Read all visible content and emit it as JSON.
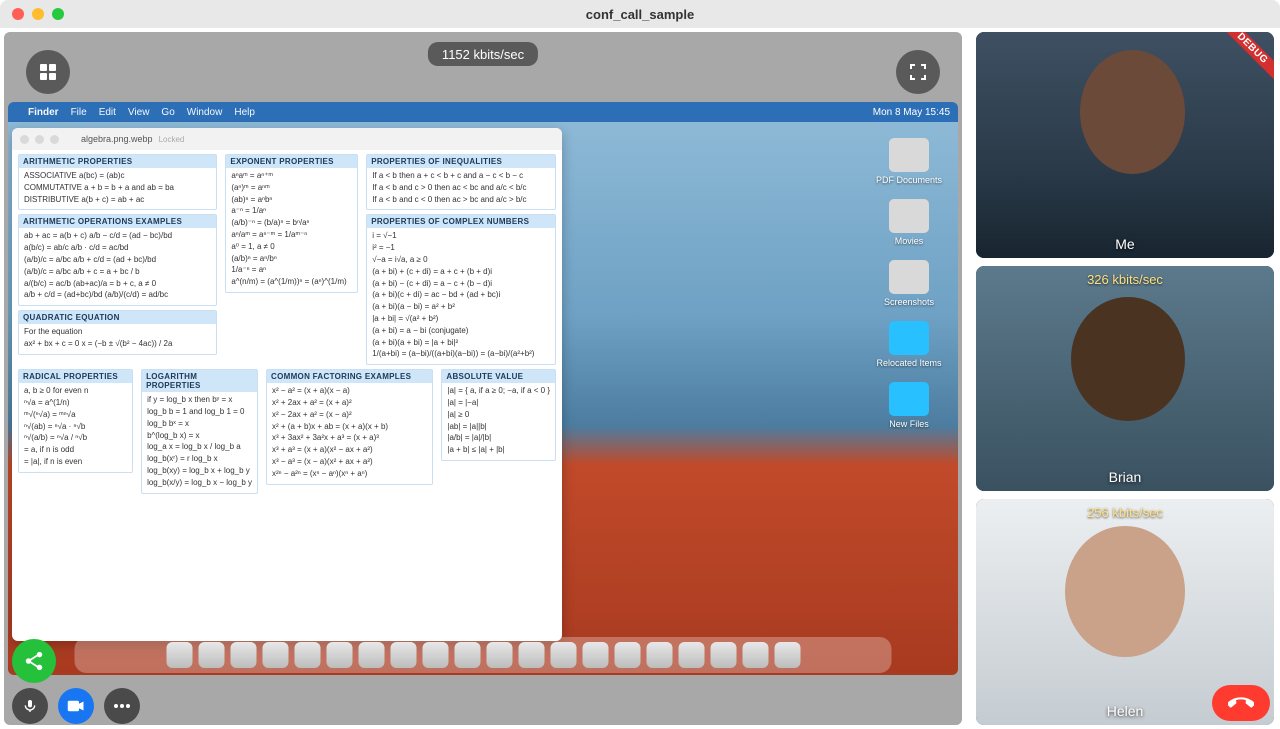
{
  "window": {
    "title": "conf_call_sample"
  },
  "overlay": {
    "bitrate": "1152 kbits/sec"
  },
  "menubar": {
    "items": [
      "Finder",
      "File",
      "Edit",
      "View",
      "Go",
      "Window",
      "Help"
    ],
    "clock": "Mon 8 May  15:45"
  },
  "doc": {
    "filename": "algebra.png.webp",
    "status": "Locked",
    "sections": {
      "arith_prop": {
        "title": "ARITHMETIC PROPERTIES",
        "rows": [
          "ASSOCIATIVE      a(bc) = (ab)c",
          "COMMUTATIVE    a + b = b + a  and  ab = ba",
          "DISTRIBUTIVE     a(b + c) = ab + ac"
        ]
      },
      "arith_ops": {
        "title": "ARITHMETIC OPERATIONS EXAMPLES",
        "rows": [
          "ab + ac = a(b + c)        a/b − c/d = (ad − bc)/bd",
          "a(b/c) = ab/c               a/b · c/d = ac/bd",
          "(a/b)/c = a/bc              a/b + c/d = (ad + bc)/bd",
          "(a/b)/c = a/bc              a/b + c = a + bc / b",
          "a/(b/c) = ac/b              (ab+ac)/a = b + c, a ≠ 0",
          "a/b + c/d = (ad+bc)/bd   (a/b)/(c/d) = ad/bc"
        ]
      },
      "quadratic": {
        "title": "QUADRATIC EQUATION",
        "rows": [
          "For the equation",
          "ax² + bx + c = 0     x = (−b ± √(b² − 4ac)) / 2a"
        ]
      },
      "radical": {
        "title": "RADICAL PROPERTIES",
        "rows": [
          "a, b ≥ 0 for even n",
          "ⁿ√a = a^(1/n)",
          "ᵐ√(ⁿ√a) = ᵐⁿ√a",
          "ⁿ√(ab) = ⁿ√a · ⁿ√b",
          "ⁿ√(a/b) = ⁿ√a / ⁿ√b",
          "= a, if n is odd",
          "= |a|, if n is even"
        ]
      },
      "exponent": {
        "title": "EXPONENT PROPERTIES",
        "rows": [
          "aⁿaᵐ = aⁿ⁺ᵐ",
          "(aⁿ)ᵐ = aⁿᵐ",
          "(ab)ⁿ = aⁿbⁿ",
          "a⁻ⁿ = 1/aⁿ",
          "(a/b)⁻ⁿ = (b/a)ⁿ = bⁿ/aⁿ",
          "aⁿ/aᵐ = aⁿ⁻ᵐ = 1/aᵐ⁻ⁿ",
          "a⁰ = 1, a ≠ 0",
          "(a/b)ⁿ = aⁿ/bⁿ",
          "1/a⁻ⁿ = aⁿ",
          "a^(n/m) = (a^(1/m))ⁿ = (aⁿ)^(1/m)"
        ]
      },
      "logarithm": {
        "title": "LOGARITHM PROPERTIES",
        "rows": [
          "if y = log_b x  then  bʸ = x",
          "log_b b = 1  and  log_b 1 = 0",
          "log_b bˣ = x",
          "b^(log_b x) = x",
          "log_a x = log_b x / log_b a",
          "log_b(xʳ) = r log_b x",
          "log_b(xy) = log_b x + log_b y",
          "log_b(x/y) = log_b x − log_b y"
        ]
      },
      "inequalities": {
        "title": "PROPERTIES OF INEQUALITIES",
        "rows": [
          "If a < b then a + c < b + c and a − c < b − c",
          "If a < b and c > 0 then ac < bc and a/c < b/c",
          "If a < b and c < 0 then ac > bc and a/c > b/c"
        ]
      },
      "complex": {
        "title": "PROPERTIES OF COMPLEX NUMBERS",
        "rows": [
          "i = √−1",
          "i² = −1",
          "√−a = i√a,     a ≥ 0",
          "(a + bi) + (c + di) = a + c + (b + d)i",
          "(a + bi) − (c + di) = a − c + (b − d)i",
          "(a + bi)(c + di) = ac − bd + (ad + bc)i",
          "(a + bi)(a − bi) = a² + b²",
          "|a + bi| = √(a² + b²)",
          "(a + bi) = a − bi   (conjugate)",
          "(a + bi)(a + bi) = |a + bi|²",
          "1/(a+bi) = (a−bi)/((a+bi)(a−bi)) = (a−bi)/(a²+b²)"
        ]
      },
      "factoring": {
        "title": "COMMON FACTORING EXAMPLES",
        "rows": [
          "x² − a² = (x + a)(x − a)",
          "x² + 2ax + a² = (x + a)²",
          "x² − 2ax + a² = (x − a)²",
          "x² + (a + b)x + ab = (x + a)(x + b)",
          "x³ + 3ax² + 3a²x + a³ = (x + a)³",
          "x³ + a³ = (x + a)(x² − ax + a²)",
          "x³ − a³ = (x − a)(x² + ax + a²)",
          "x²ⁿ − a²ⁿ = (xⁿ − aⁿ)(xⁿ + aⁿ)"
        ]
      },
      "absolute": {
        "title": "ABSOLUTE VALUE",
        "rows": [
          "|a| = { a, if a ≥ 0;  −a, if a < 0 }",
          "|a| = |−a|",
          "|a| ≥ 0",
          "|ab| = |a||b|",
          "|a/b| = |a|/|b|",
          "|a + b| ≤ |a| + |b|"
        ]
      }
    }
  },
  "desktop": {
    "icons": [
      {
        "label": "PDF Documents",
        "kind": "file"
      },
      {
        "label": "Movies",
        "kind": "file"
      },
      {
        "label": "Screenshots",
        "kind": "file"
      },
      {
        "label": "Relocated Items",
        "kind": "folder"
      },
      {
        "label": "New Files",
        "kind": "folder"
      }
    ]
  },
  "participants": [
    {
      "name": "Me",
      "bitrate": "",
      "debug": true
    },
    {
      "name": "Brian",
      "bitrate": "326 kbits/sec",
      "debug": false
    },
    {
      "name": "Helen",
      "bitrate": "256 kbits/sec",
      "debug": false
    }
  ],
  "debugRibbon": "DEBUG"
}
